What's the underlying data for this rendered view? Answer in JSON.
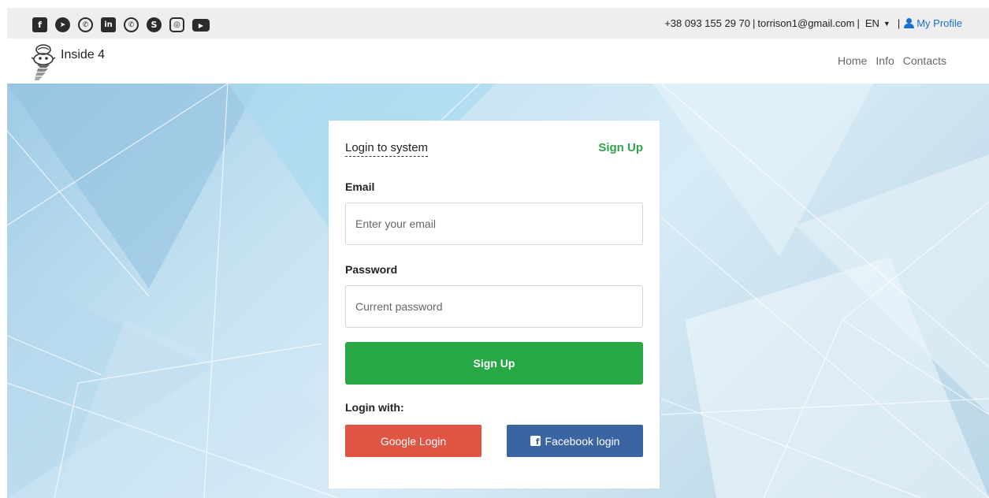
{
  "topbar": {
    "social_icons": [
      {
        "name": "facebook-icon",
        "glyph": "f"
      },
      {
        "name": "telegram-icon",
        "glyph": "➤"
      },
      {
        "name": "viber-icon",
        "glyph": "✆"
      },
      {
        "name": "linkedin-icon",
        "glyph": "in"
      },
      {
        "name": "whatsapp-icon",
        "glyph": "✆"
      },
      {
        "name": "skype-icon",
        "glyph": "S"
      },
      {
        "name": "instagram-icon",
        "glyph": "◎"
      },
      {
        "name": "youtube-icon",
        "glyph": "▶"
      }
    ],
    "phone": "+38 093 155 29 70",
    "email": "torrison1@gmail.com",
    "separator": "|",
    "language": "EN",
    "profile_label": "My Profile"
  },
  "header": {
    "brand": "Inside 4",
    "nav": [
      "Home",
      "Info",
      "Contacts"
    ]
  },
  "login": {
    "title": "Login to system",
    "signup_link": "Sign Up",
    "email_label": "Email",
    "email_placeholder": "Enter your email",
    "password_label": "Password",
    "password_placeholder": "Current password",
    "submit_label": "Sign Up",
    "login_with_label": "Login with:",
    "google_label": "Google Login",
    "facebook_label": "Facebook login"
  },
  "colors": {
    "accent_green": "#28a745",
    "google_red": "#e05444",
    "facebook_blue": "#3b64a3",
    "profile_blue": "#1a6fd0"
  }
}
